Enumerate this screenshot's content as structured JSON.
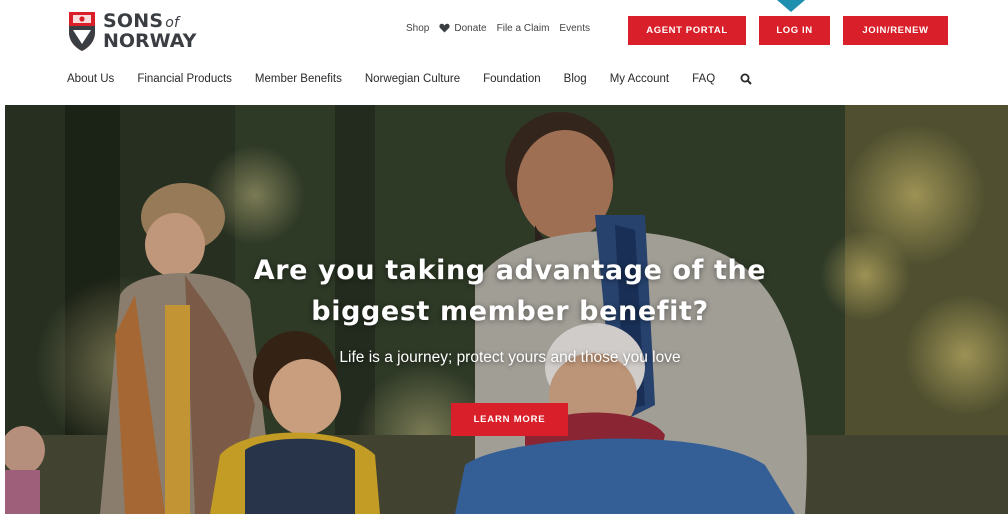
{
  "brand": {
    "line1": "SONS",
    "line1_suffix": "of",
    "line2": "NORWAY",
    "shield_color": "#d9202a"
  },
  "utility_nav": {
    "shop": "Shop",
    "donate": "Donate",
    "file_claim": "File a Claim",
    "events": "Events"
  },
  "header_buttons": {
    "agent_portal": "AGENT PORTAL",
    "log_in": "LOG IN",
    "join_renew": "JOIN/RENEW"
  },
  "main_nav": {
    "items": [
      "About Us",
      "Financial Products",
      "Member Benefits",
      "Norwegian Culture",
      "Foundation",
      "Blog",
      "My Account",
      "FAQ"
    ]
  },
  "hero": {
    "title_line1": "Are you taking advantage of the",
    "title_line2": "biggest member benefit?",
    "subtitle": "Life is a journey; protect yours and those you love",
    "cta": "LEARN MORE"
  },
  "colors": {
    "accent": "#d9202a",
    "indicator": "#1f8fb0",
    "text": "#2a2a2a"
  },
  "icons": {
    "heart": "heart-icon",
    "search": "search-icon",
    "shield": "shield-logo-icon"
  }
}
